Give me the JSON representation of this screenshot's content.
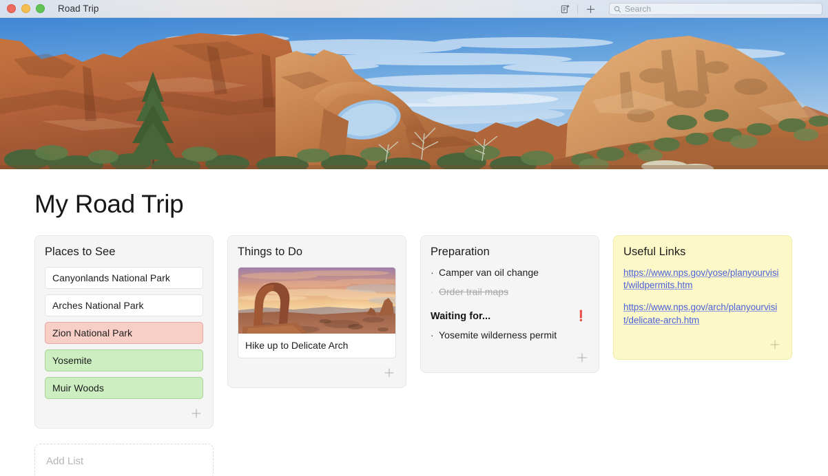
{
  "window": {
    "title": "Road Trip",
    "traffic_lights": [
      {
        "name": "close",
        "color": "#ed6a5e"
      },
      {
        "name": "minimize",
        "color": "#f5bf4f"
      },
      {
        "name": "zoom",
        "color": "#61c454"
      }
    ],
    "toolbar": {
      "new_note_icon": "new-note-icon",
      "add_icon": "plus-icon",
      "search_icon": "search-icon",
      "search_placeholder": "Search",
      "search_value": ""
    }
  },
  "hero": {
    "alt": "Red sandstone arch formation under blue sky at Arches National Park"
  },
  "board": {
    "title": "My Road Trip",
    "add_list_placeholder": "Add List",
    "lists": [
      {
        "title": "Places to See",
        "style": "default",
        "items": [
          {
            "text": "Canyonlands National Park",
            "color": "white"
          },
          {
            "text": "Arches National Park",
            "color": "white"
          },
          {
            "text": "Zion National Park",
            "color": "pink"
          },
          {
            "text": "Yosemite",
            "color": "green"
          },
          {
            "text": "Muir Woods",
            "color": "green"
          }
        ],
        "add_icon": "plus-icon"
      },
      {
        "title": "Things to Do",
        "style": "default",
        "photo_item": {
          "caption": "Hike up to Delicate Arch",
          "alt": "Delicate Arch at sunset"
        },
        "add_icon": "plus-icon"
      },
      {
        "title": "Preparation",
        "style": "default",
        "bullets": [
          {
            "text": "Camper van oil change",
            "done": false
          },
          {
            "text": "Order trail maps",
            "done": true
          }
        ],
        "subheading": "Waiting for...",
        "subheading_badge": "❗",
        "bullets2": [
          {
            "text": "Yosemite wilderness permit",
            "done": false
          }
        ],
        "add_icon": "plus-icon"
      },
      {
        "title": "Useful Links",
        "style": "yellow",
        "links": [
          "https://www.nps.gov/yose/planyourvisit/wildpermits.htm",
          "https://www.nps.gov/arch/planyourvisit/delicate-arch.htm"
        ],
        "add_icon": "plus-icon"
      }
    ]
  },
  "colors": {
    "card_bg": "#f5f5f5",
    "yellow_card_bg": "#fcf8c8",
    "pink_item": "#f8cfc7",
    "green_item": "#cdeec1",
    "link": "#4b62d9",
    "alert": "#e2563a"
  }
}
